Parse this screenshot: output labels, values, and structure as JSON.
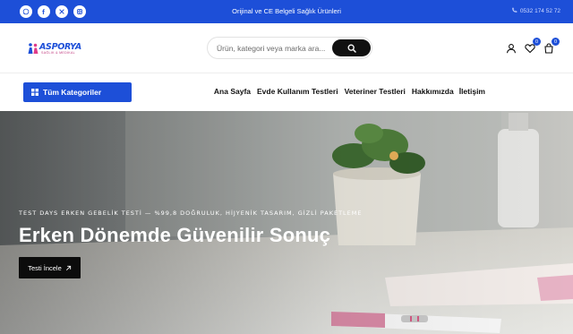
{
  "topbar": {
    "social": [
      {
        "icon": "whatsapp-icon",
        "glyph": "✆"
      },
      {
        "icon": "facebook-icon",
        "glyph": "f"
      },
      {
        "icon": "x-twitter-icon",
        "glyph": "𝕏"
      },
      {
        "icon": "instagram-icon",
        "glyph": "◎"
      }
    ],
    "promo_text": "Orijinal ve CE Belgeli Sağlık Ürünleri",
    "phone": "0532 174 52 72"
  },
  "header": {
    "logo_text": "ASPORYA",
    "logo_subtext": "SAĞLIK & MEDİKAL",
    "search_placeholder": "Ürün, kategori veya marka ara...",
    "wishlist_count": "0",
    "cart_count": "0"
  },
  "nav": {
    "categories_label": "Tüm Kategoriler",
    "menu": [
      "Ana Sayfa",
      "Evde Kullanım Testleri",
      "Veteriner Testleri",
      "Hakkımızda",
      "İletişim"
    ]
  },
  "hero": {
    "subtitle": "TEST DAYS ERKEN GEBELİK TESTİ — %99,8 DOĞRULUK, HİJYENİK TASARIM, GİZLİ PAKETLEME",
    "title": "Erken Dönemde Güvenilir Sonuç",
    "cta_label": "Testi İncele"
  },
  "colors": {
    "brand_blue": "#1d4fd8",
    "dark": "#111111",
    "white": "#ffffff"
  }
}
